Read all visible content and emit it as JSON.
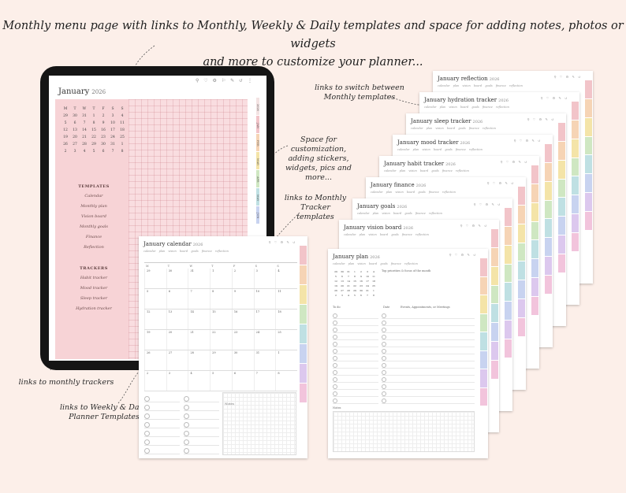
{
  "headline": {
    "line1": "Monthly menu page with links to Monthly, Weekly & Daily templates and  space for adding notes, photos or widgets",
    "line2": "and more to customize your planner..."
  },
  "annotations": {
    "switch_templates": "links to switch between Monthly templates",
    "customization": "Space for customization, adding stickers, widgets, pics and more...",
    "tracker_templates": "links to Monthly Tracker templates",
    "monthly_trackers": "links to monthly trackers",
    "weekly_daily": "links to Weekly & Daily Planner Templates"
  },
  "tablet": {
    "title": "January",
    "year": "2026",
    "mini_calendar": {
      "days": [
        "M",
        "T",
        "W",
        "T",
        "F",
        "S",
        "S"
      ],
      "weeks": [
        [
          "29",
          "30",
          "31",
          "1",
          "2",
          "3",
          "4"
        ],
        [
          "5",
          "6",
          "7",
          "8",
          "9",
          "10",
          "11"
        ],
        [
          "12",
          "13",
          "14",
          "15",
          "16",
          "17",
          "18"
        ],
        [
          "19",
          "20",
          "21",
          "22",
          "23",
          "24",
          "25"
        ],
        [
          "26",
          "27",
          "28",
          "29",
          "30",
          "31",
          "1"
        ],
        [
          "2",
          "3",
          "4",
          "5",
          "6",
          "7",
          "8"
        ]
      ]
    },
    "templates_heading": "TEMPLATES",
    "templates": [
      "Calendar",
      "Monthly plan",
      "Vision board",
      "Monthly goals",
      "Finance",
      "Reflection"
    ],
    "trackers_heading": "TRACKERS",
    "trackers": [
      "Habit tracker",
      "Mood tracker",
      "Sleep tracker",
      "Hydration tracker"
    ],
    "tabs": [
      "2026",
      "JAN",
      "FEB",
      "MAR",
      "APR",
      "MAY",
      "JUN"
    ]
  },
  "nav_links": "calendar  plan  vision board  goals  finance  reflection",
  "calendar_page": {
    "title": "January calendar",
    "year": "2026",
    "days": [
      "M",
      "T",
      "W",
      "T",
      "F",
      "S",
      "S"
    ],
    "weeks": [
      [
        "29",
        "30",
        "31",
        "1",
        "2",
        "3",
        "4"
      ],
      [
        "5",
        "6",
        "7",
        "8",
        "9",
        "10",
        "11"
      ],
      [
        "12",
        "13",
        "14",
        "15",
        "16",
        "17",
        "18"
      ],
      [
        "19",
        "20",
        "21",
        "22",
        "23",
        "24",
        "25"
      ],
      [
        "26",
        "27",
        "28",
        "29",
        "30",
        "31",
        "1"
      ],
      [
        "2",
        "3",
        "4",
        "5",
        "6",
        "7",
        "8"
      ]
    ],
    "notes_label": "Notes"
  },
  "stack_pages": [
    {
      "title": "January reflection",
      "year": "2026"
    },
    {
      "title": "January hydration tracker",
      "year": "2026"
    },
    {
      "title": "January sleep tracker",
      "year": "2026"
    },
    {
      "title": "January mood tracker",
      "year": "2026"
    },
    {
      "title": "January habit tracker",
      "year": "2026"
    },
    {
      "title": "January finance",
      "year": "2026"
    },
    {
      "title": "January goals",
      "year": "2026"
    },
    {
      "title": "January vision board",
      "year": "2026"
    }
  ],
  "plan_page": {
    "title": "January plan",
    "year": "2026",
    "priorities_label": "Top priorities & focus of the month",
    "todo_label": "To do",
    "date_label": "Date",
    "events_label": "Events, Appointments, or Meetings",
    "notes_label": "Notes"
  },
  "tab_colors": [
    "#f2c4c9",
    "#f6d4b5",
    "#f4e4a8",
    "#cfe7c2",
    "#bfe0e3",
    "#c8d3f0",
    "#dcc8ee",
    "#f2c4dc"
  ]
}
